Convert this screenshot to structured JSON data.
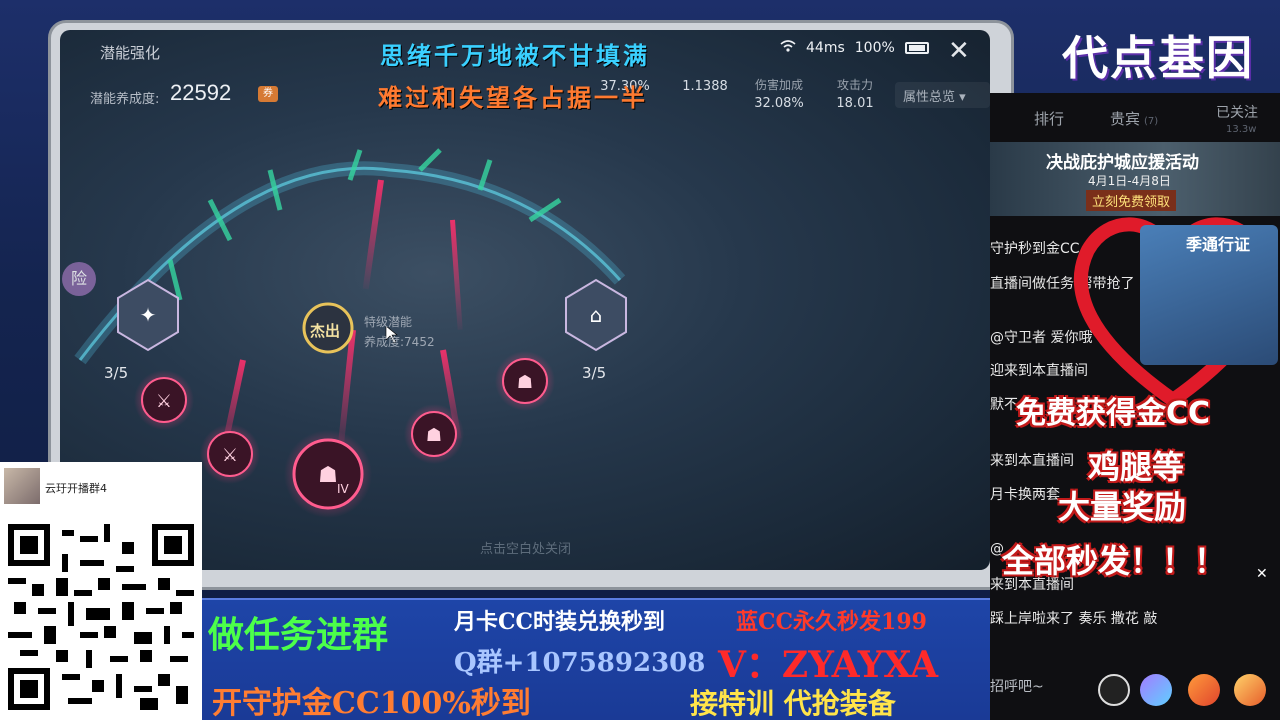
{
  "game": {
    "title": "潜能强化",
    "culture_label": "潜能养成度:",
    "culture_value": "22592",
    "culture_icon": "ticket-icon",
    "stats": [
      {
        "label": "",
        "value": "37.30%"
      },
      {
        "label": "",
        "value": "1.1388"
      },
      {
        "label": "伤害加成",
        "value": "32.08%"
      },
      {
        "label": "攻击力",
        "value": "18.01"
      }
    ],
    "attr_overview": "属性总览 ▾",
    "status": {
      "ping": "44ms",
      "battery": "100%"
    },
    "close": "✕",
    "nodes": {
      "left_count": "3/5",
      "right_count": "3/5",
      "center_badge": "杰出",
      "roman": "IV"
    },
    "tooltip": {
      "line1": "特级潜能",
      "line2": "养成度:7452"
    },
    "bottom_hint": "点击空白处关闭",
    "side_badge": "险"
  },
  "lyrics": {
    "line1": "思绪千万地被不甘填满",
    "line2": "难过和失望各占据一半"
  },
  "live": {
    "brand": "代点基因",
    "tabs": {
      "rank": "排行",
      "vip": "贵宾",
      "vip_count": "(7)",
      "followed": "已关注",
      "followers": "13.3w"
    },
    "banner": {
      "title": "决战庇护城应援活动",
      "date": "4月1日-4月8日",
      "button": "立刻免费领取"
    },
    "chat": [
      "守护秒到金CC",
      "直播间做任务 帮带抢了",
      "@守卫者 爱你哦",
      "迎来到本直播间",
      "默不",
      "来到本直播间",
      "月卡换两套",
      "@",
      "来到本直播间",
      "踩上岸啦来了 奏乐 撒花 敲"
    ],
    "pass_title": "季通行证",
    "promo": {
      "line1": "免费获得金CC",
      "line2": "鸡腿等",
      "line3": "大量奖励",
      "line4": "全部秒发！！！"
    },
    "input_hint": "招呼吧~",
    "close_x": "✕"
  },
  "qr": {
    "group_name": "云玗开播群4"
  },
  "ads": {
    "a1": "做任务进群",
    "a2": "月卡CC时装兑换秒到",
    "a3": "蓝CC永久秒发199",
    "a4": "Q群+1075892308",
    "a5": "V：ZYAYXA",
    "a6": "开守护金CC100%秒到",
    "a7": "接特训 代抢装备"
  }
}
